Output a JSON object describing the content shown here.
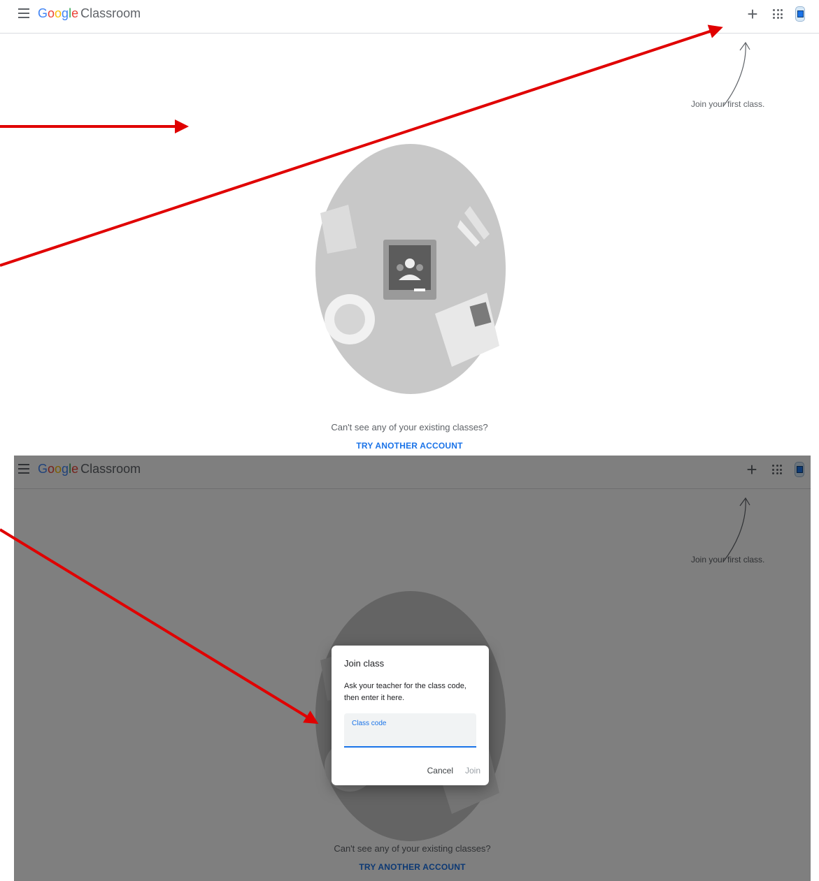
{
  "app": {
    "brand_google": [
      "G",
      "o",
      "o",
      "g",
      "l",
      "e"
    ],
    "brand_product": "Classroom"
  },
  "colors": {
    "google_letters": [
      "#4285f4",
      "#ea4335",
      "#fbbc05",
      "#4285f4",
      "#34a853",
      "#ea4335"
    ],
    "accent": "#1a73e8",
    "annotation_red": "#e00000"
  },
  "icons": {
    "menu": "hamburger-menu-icon",
    "add": "plus-icon",
    "apps": "apps-grid-icon",
    "account": "account-avatar-icon",
    "illustration": "classroom-desk-illustration"
  },
  "empty_state": {
    "hint": "Join your first class.",
    "question": "Can't see any of your existing classes?",
    "link": "TRY ANOTHER ACCOUNT"
  },
  "dialog": {
    "title": "Join class",
    "description": "Ask your teacher for the class code, then enter it here.",
    "field_label": "Class code",
    "field_value": "",
    "cancel": "Cancel",
    "join": "Join"
  }
}
